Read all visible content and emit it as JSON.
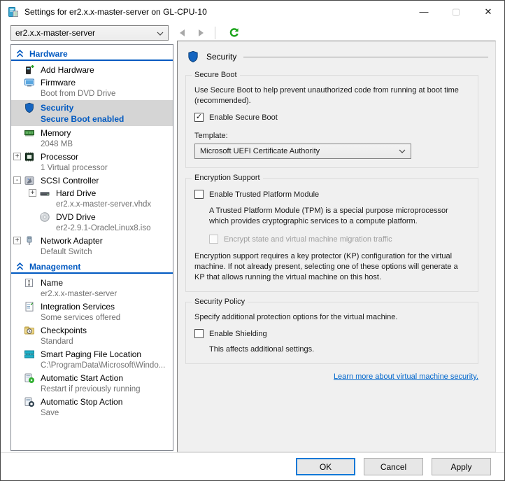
{
  "window": {
    "title": "Settings for er2.x.x-master-server on GL-CPU-10",
    "controls": {
      "minimize": "—",
      "maximize": "▢",
      "close": "✕"
    }
  },
  "toolbar": {
    "vm_selector_value": "er2.x.x-master-server"
  },
  "sidebar": {
    "hardware": {
      "header": "Hardware",
      "items": [
        {
          "label": "Add Hardware"
        },
        {
          "label": "Firmware",
          "sub": "Boot from DVD Drive"
        },
        {
          "label": "Security",
          "sub": "Secure Boot enabled"
        },
        {
          "label": "Memory",
          "sub": "2048 MB"
        },
        {
          "label": "Processor",
          "sub": "1 Virtual processor",
          "expander": "+"
        },
        {
          "label": "SCSI Controller",
          "expander": "-"
        },
        {
          "label": "Hard Drive",
          "sub": "er2.x.x-master-server.vhdx",
          "expander": "+"
        },
        {
          "label": "DVD Drive",
          "sub": "er2-2.9.1-OracleLinux8.iso"
        },
        {
          "label": "Network Adapter",
          "sub": "Default Switch",
          "expander": "+"
        }
      ]
    },
    "management": {
      "header": "Management",
      "items": [
        {
          "label": "Name",
          "sub": "er2.x.x-master-server"
        },
        {
          "label": "Integration Services",
          "sub": "Some services offered"
        },
        {
          "label": "Checkpoints",
          "sub": "Standard"
        },
        {
          "label": "Smart Paging File Location",
          "sub": "C:\\ProgramData\\Microsoft\\Windo..."
        },
        {
          "label": "Automatic Start Action",
          "sub": "Restart if previously running"
        },
        {
          "label": "Automatic Stop Action",
          "sub": "Save"
        }
      ]
    }
  },
  "panel": {
    "title": "Security",
    "secure_boot": {
      "group_label": "Secure Boot",
      "description": "Use Secure Boot to help prevent unauthorized code from running at boot time (recommended).",
      "checkbox_label": "Enable Secure Boot",
      "checkbox_checked": true,
      "template_label": "Template:",
      "template_value": "Microsoft UEFI Certificate Authority"
    },
    "encryption": {
      "group_label": "Encryption Support",
      "tpm_checkbox_label": "Enable Trusted Platform Module",
      "tpm_checkbox_checked": false,
      "tpm_description": "A Trusted Platform Module (TPM) is a special purpose microprocessor which provides cryptographic services to a compute platform.",
      "encrypt_checkbox_label": "Encrypt state and virtual machine migration traffic",
      "encrypt_checkbox_enabled": false,
      "kp_note": "Encryption support requires a key protector (KP) configuration for the virtual machine. If not already present, selecting one of these options will generate a KP that allows running the virtual machine on this host."
    },
    "security_policy": {
      "group_label": "Security Policy",
      "description": "Specify additional protection options for the virtual machine.",
      "checkbox_label": "Enable Shielding",
      "checkbox_checked": false,
      "note": "This affects additional settings."
    },
    "learn_more_link": "Learn more about virtual machine security."
  },
  "footer": {
    "ok": "OK",
    "cancel": "Cancel",
    "apply": "Apply"
  },
  "colors": {
    "accent_blue": "#0059c1",
    "link_blue": "#0066cc",
    "refresh_green": "#17a317",
    "selected_row_bg": "#d5d5d5",
    "panel_bg": "#f0f0f0",
    "ok_focus_border": "#0078d7"
  }
}
